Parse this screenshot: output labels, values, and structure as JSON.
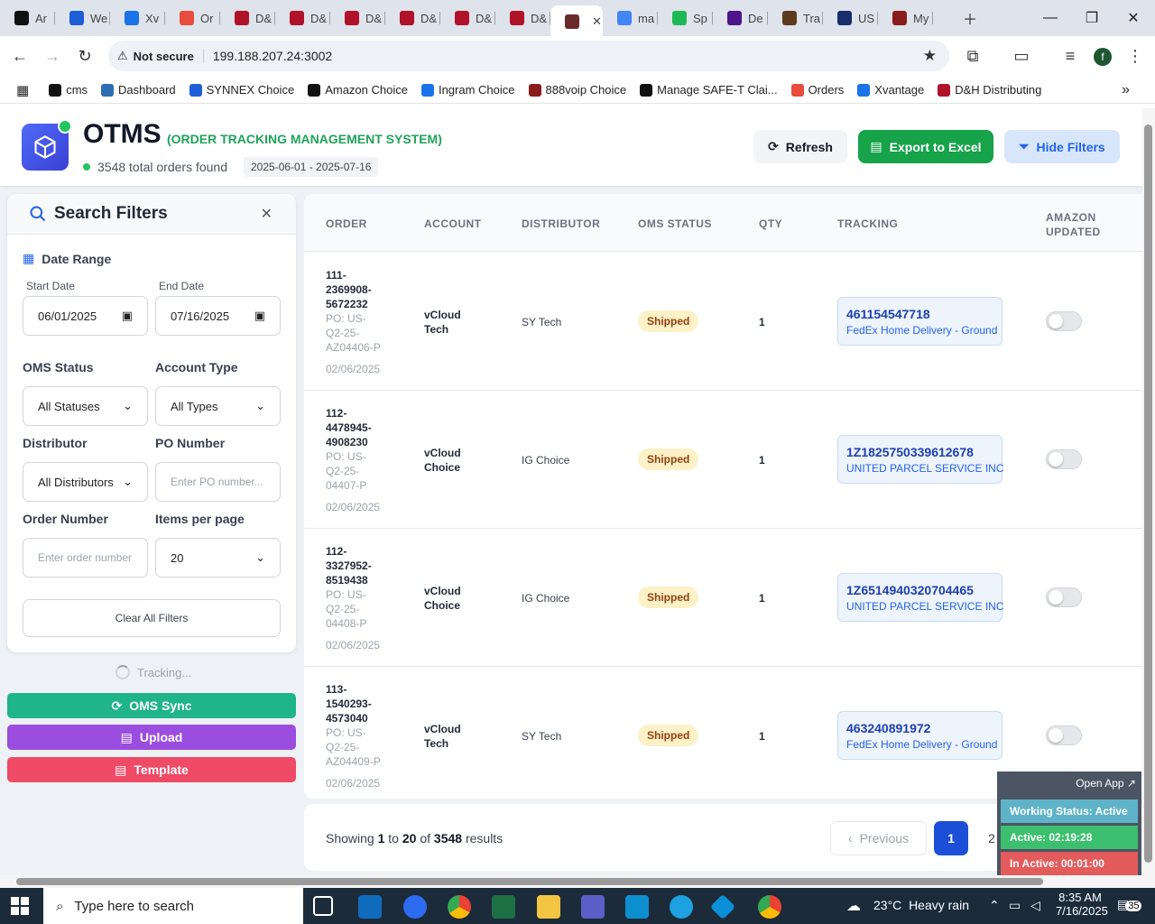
{
  "browser": {
    "tabs": [
      {
        "label": "Ar",
        "color": "#111111"
      },
      {
        "label": "We",
        "color": "#1e5ed6"
      },
      {
        "label": "Xv",
        "color": "#1a73e8"
      },
      {
        "label": "Or",
        "color": "#e74c3c"
      },
      {
        "label": "D&",
        "color": "#b0122a"
      },
      {
        "label": "D&",
        "color": "#b0122a"
      },
      {
        "label": "D&",
        "color": "#b0122a"
      },
      {
        "label": "D&",
        "color": "#b0122a"
      },
      {
        "label": "D&",
        "color": "#b0122a"
      },
      {
        "label": "D&",
        "color": "#b0122a"
      },
      {
        "label": "",
        "color": "#6b2a2a",
        "active": true
      },
      {
        "label": "ma",
        "color": "#4285f4"
      },
      {
        "label": "Sp",
        "color": "#1db954"
      },
      {
        "label": "De",
        "color": "#4d148c"
      },
      {
        "label": "Tra",
        "color": "#5b3a1e"
      },
      {
        "label": "US",
        "color": "#1a2d6b"
      },
      {
        "label": "My",
        "color": "#8a1c1c"
      }
    ],
    "not_secure": "Not secure",
    "url": "199.188.207.24:3002",
    "profile_initial": "f",
    "bookmarks": [
      {
        "label": "cms",
        "color": "#111111"
      },
      {
        "label": "Dashboard",
        "color": "#2e6db4"
      },
      {
        "label": "SYNNEX Choice",
        "color": "#1e5ed6"
      },
      {
        "label": "Amazon Choice",
        "color": "#111111"
      },
      {
        "label": "Ingram Choice",
        "color": "#1a73e8"
      },
      {
        "label": "888voip Choice",
        "color": "#8a1c1c"
      },
      {
        "label": "Manage SAFE-T Clai...",
        "color": "#111111"
      },
      {
        "label": "Orders",
        "color": "#e74c3c"
      },
      {
        "label": "Xvantage",
        "color": "#1a73e8"
      },
      {
        "label": "D&H Distributing",
        "color": "#b0122a"
      }
    ]
  },
  "header": {
    "title": "OTMS",
    "subtitle": "(ORDER TRACKING MANAGEMENT SYSTEM)",
    "orders_found": "3548 total orders found",
    "date_range": "2025-06-01 - 2025-07-16",
    "refresh_label": "Refresh",
    "export_label": "Export to Excel",
    "hide_filters_label": "Hide Filters"
  },
  "filters": {
    "title": "Search Filters",
    "date_range_label": "Date Range",
    "start_date_label": "Start Date",
    "start_date": "06/01/2025",
    "end_date_label": "End Date",
    "end_date": "07/16/2025",
    "oms_status_label": "OMS Status",
    "oms_status_value": "All Statuses",
    "account_type_label": "Account Type",
    "account_type_value": "All Types",
    "distributor_label": "Distributor",
    "distributor_value": "All Distributors",
    "po_label": "PO Number",
    "po_placeholder": "Enter PO number...",
    "order_label": "Order Number",
    "order_placeholder": "Enter order number",
    "per_page_label": "Items per page",
    "per_page_value": "20",
    "clear_label": "Clear All Filters"
  },
  "side_actions": {
    "tracking": "Tracking...",
    "oms_sync": "OMS Sync",
    "upload": "Upload",
    "template": "Template"
  },
  "table": {
    "columns": [
      "ORDER",
      "ACCOUNT",
      "DISTRIBUTOR",
      "OMS STATUS",
      "QTY",
      "TRACKING",
      "AMAZON UPDATED"
    ],
    "rows": [
      {
        "order": "111-2369908-5672232",
        "po": "PO: US-Q2-25-AZ04406-P",
        "date": "02/06/2025",
        "account": "vCloud Tech",
        "distributor": "SY Tech",
        "status": "Shipped",
        "qty": "1",
        "tracking": "461154547718",
        "carrier": "FedEx Home Delivery - Ground"
      },
      {
        "order": "112-4478945-4908230",
        "po": "PO: US-Q2-25-04407-P",
        "date": "02/06/2025",
        "account": "vCloud Choice",
        "distributor": "IG Choice",
        "status": "Shipped",
        "qty": "1",
        "tracking": "1Z1825750339612678",
        "carrier": "UNITED PARCEL SERVICE INC"
      },
      {
        "order": "112-3327952-8519438",
        "po": "PO: US-Q2-25-04408-P",
        "date": "02/06/2025",
        "account": "vCloud Choice",
        "distributor": "IG Choice",
        "status": "Shipped",
        "qty": "1",
        "tracking": "1Z6514940320704465",
        "carrier": "UNITED PARCEL SERVICE INC"
      },
      {
        "order": "113-1540293-4573040",
        "po": "PO: US-Q2-25-AZ04409-P",
        "date": "02/06/2025",
        "account": "vCloud Tech",
        "distributor": "SY Tech",
        "status": "Shipped",
        "qty": "1",
        "tracking": "463240891972",
        "carrier": "FedEx Home Delivery - Ground"
      }
    ]
  },
  "pagination": {
    "showing_prefix": "Showing",
    "from": "1",
    "to_word": "to",
    "to": "20",
    "of_word": "of",
    "total": "3548",
    "results_word": "results",
    "previous_label": "Previous",
    "page_current": "1",
    "page_next": "2"
  },
  "widget": {
    "open_app": "Open App ↗",
    "working_status": "Working Status: Active",
    "active": "Active: 02:19:28",
    "inactive": "In Active: 00:01:00",
    "colors": {
      "status": "#5fb3c9",
      "active": "#3cbf6e",
      "inactive": "#e35b5b"
    }
  },
  "taskbar": {
    "search_placeholder": "Type here to search",
    "temperature": "23°C",
    "weather": "Heavy rain",
    "time": "8:35 AM",
    "date": "7/16/2025",
    "notifications": "35"
  },
  "colors": {
    "primary": "#3a48e0",
    "success": "#16a34a",
    "blue_btn": "#d7e6fb"
  }
}
